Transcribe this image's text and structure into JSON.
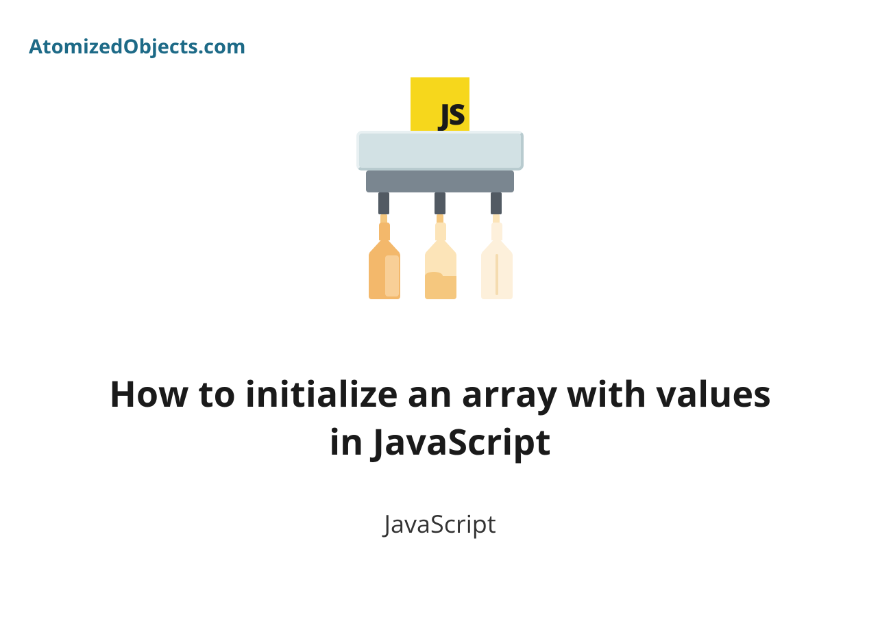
{
  "brand": {
    "name": "AtomizedObjects.com"
  },
  "illustration": {
    "badge_text": "JS"
  },
  "article": {
    "title": "How to initialize an array with values in JavaScript",
    "category": "JavaScript"
  }
}
